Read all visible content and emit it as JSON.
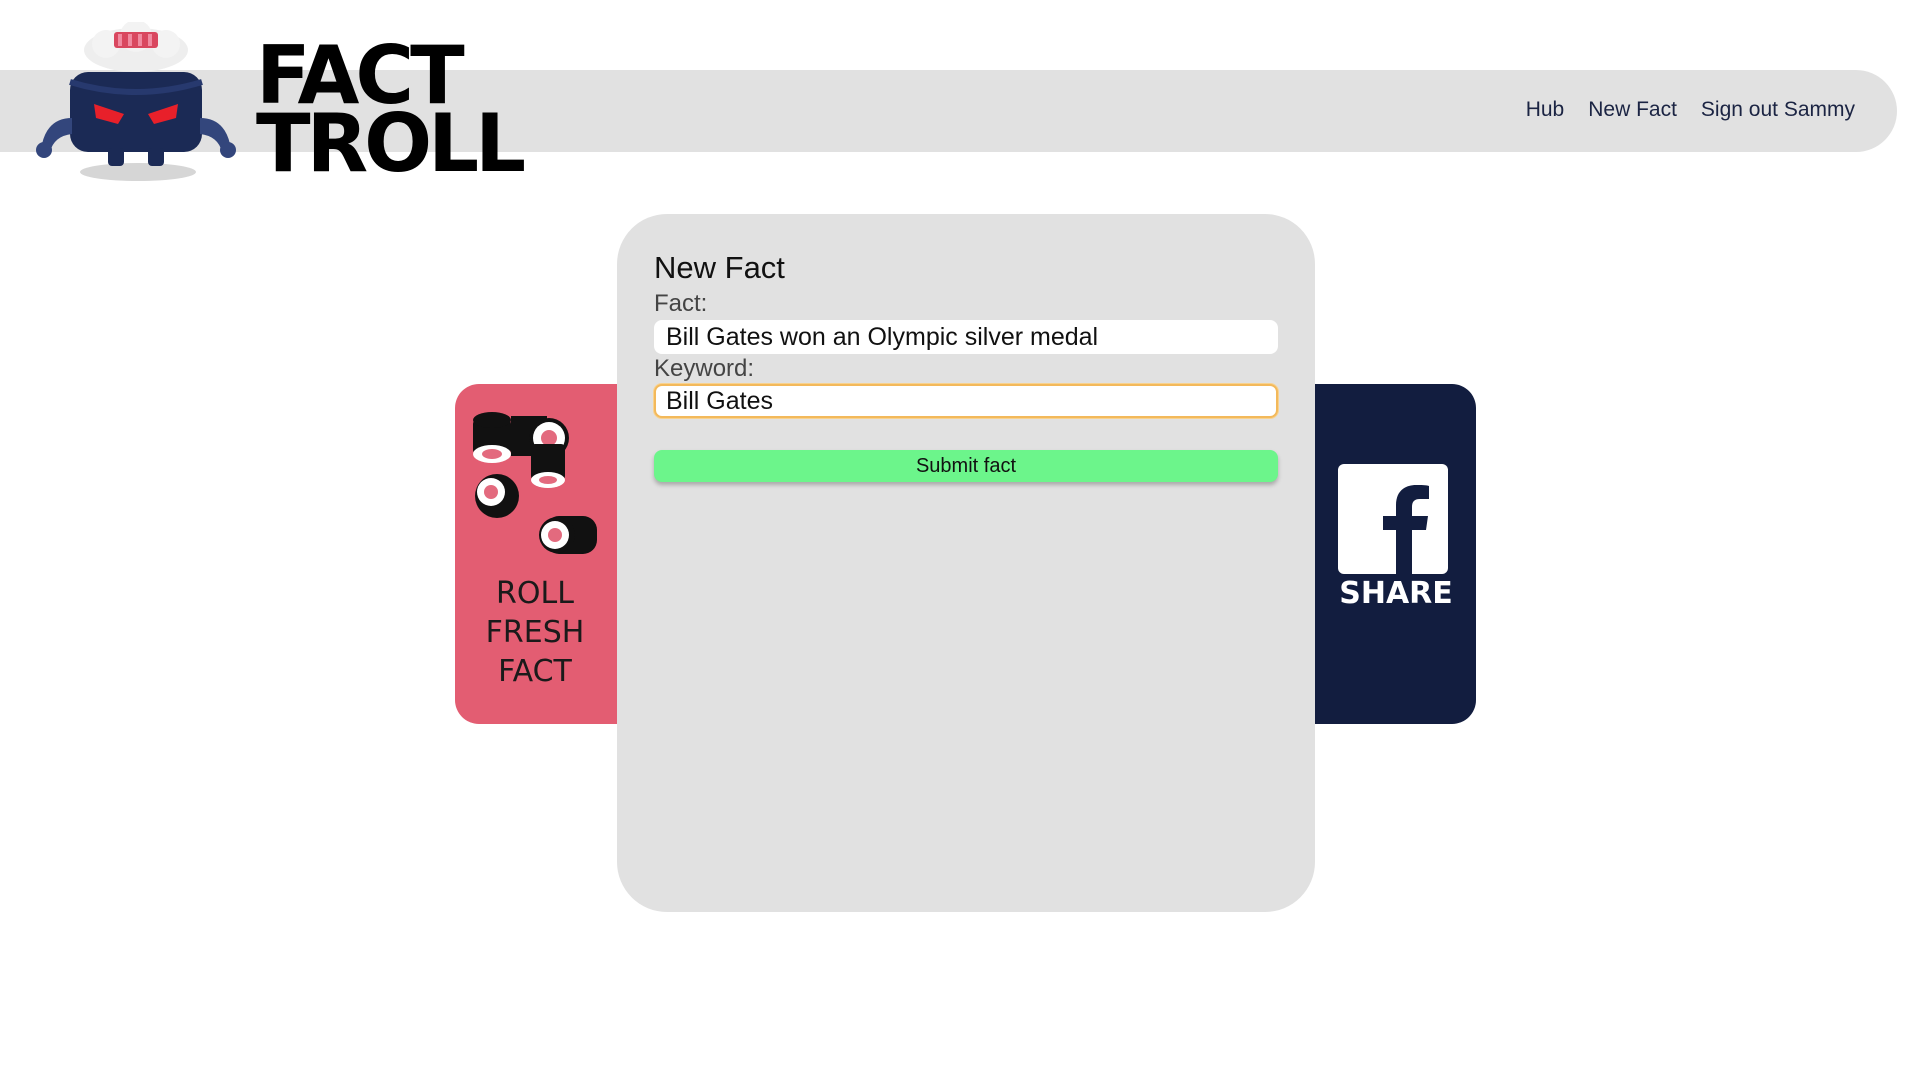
{
  "brand": {
    "line1": "FACT",
    "line2": "TROLL",
    "mascot_colors": {
      "body": "#1b2a55",
      "eyes": "#e8202a",
      "rice": "#f2f2f2",
      "fish": "#d9475f"
    }
  },
  "nav": {
    "items": [
      {
        "label": "Hub"
      },
      {
        "label": "New Fact"
      },
      {
        "label": "Sign out Sammy"
      }
    ]
  },
  "roll_tile": {
    "label": "ROLL\nFRESH\nFACT",
    "color": "#e35d72",
    "icon": "sushi-rolls-icon"
  },
  "share_tile": {
    "label": "SHARE",
    "color": "#121d3f",
    "icon": "facebook-icon"
  },
  "form": {
    "title": "New Fact",
    "fact_label": "Fact:",
    "fact_value": "Bill Gates won an Olympic silver medal",
    "keyword_label": "Keyword:",
    "keyword_value": "Bill Gates",
    "submit_label": "Submit fact",
    "submit_color": "#6cf58b",
    "focus_color": "#f3b95b"
  }
}
